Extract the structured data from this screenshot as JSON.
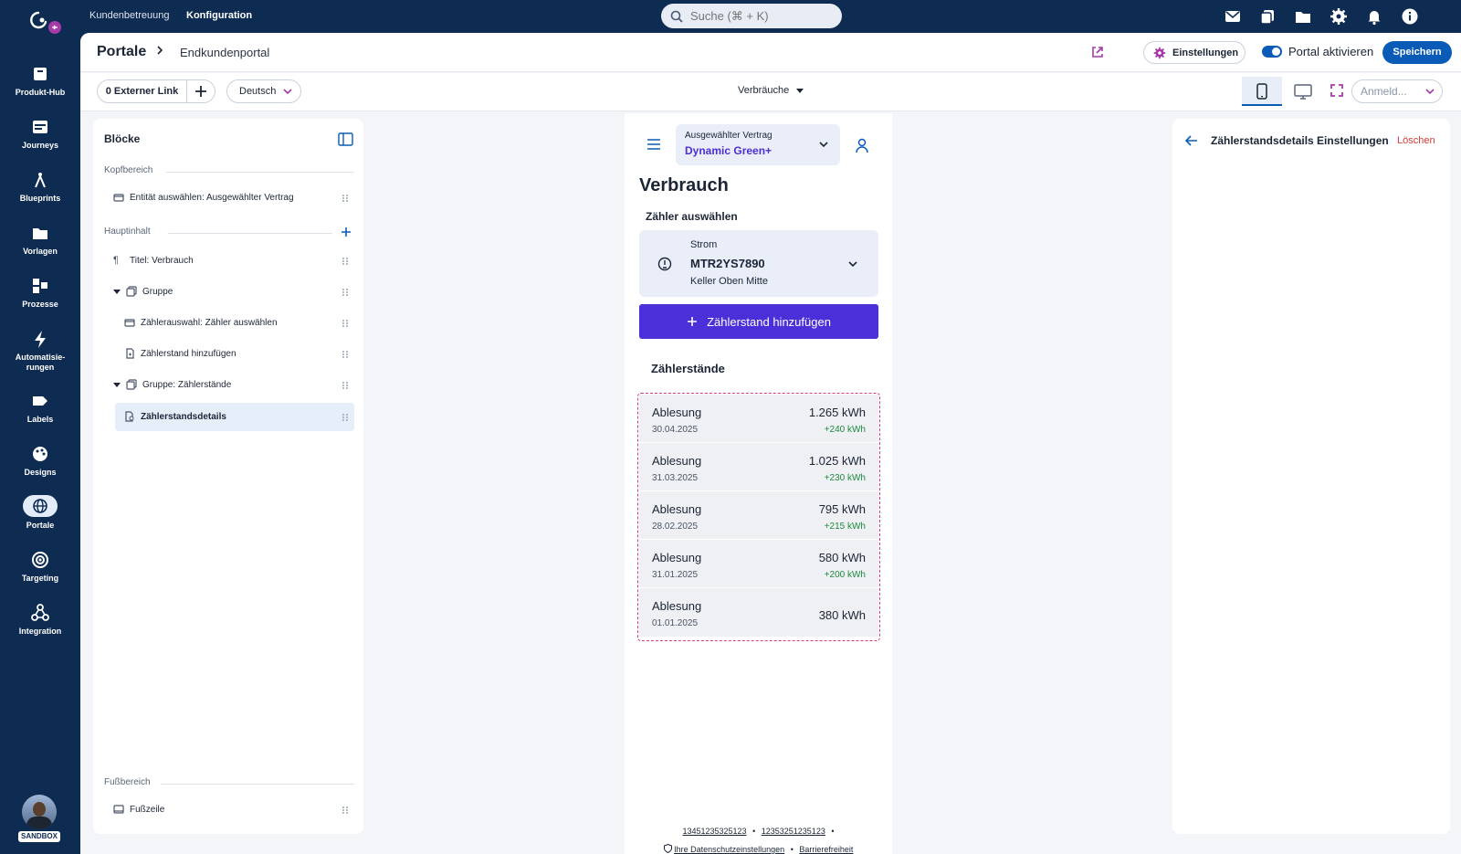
{
  "topbar": {
    "links": [
      "Kundenbetreuung",
      "Konfiguration"
    ],
    "active_link": "Konfiguration",
    "search_placeholder": "Suche (⌘ + K)",
    "icons": [
      "mail-icon",
      "copy-icon",
      "folder-icon",
      "gear-icon",
      "bell-icon",
      "info-icon"
    ]
  },
  "sidebar": {
    "items": [
      {
        "label": "Produkt-Hub",
        "icon": "box-icon"
      },
      {
        "label": "Journeys",
        "icon": "journeys-icon"
      },
      {
        "label": "Blueprints",
        "icon": "compass-icon"
      },
      {
        "label": "Vorlagen",
        "icon": "folder-icon"
      },
      {
        "label": "Prozesse",
        "icon": "process-icon"
      },
      {
        "label": "Automatisie-rungen",
        "icon": "bolt-icon"
      },
      {
        "label": "Labels",
        "icon": "tag-icon"
      },
      {
        "label": "Designs",
        "icon": "palette-icon"
      },
      {
        "label": "Portale",
        "icon": "globe-icon"
      },
      {
        "label": "Targeting",
        "icon": "target-icon"
      },
      {
        "label": "Integration",
        "icon": "integration-icon"
      }
    ],
    "active": "Portale",
    "badge": "SANDBOX"
  },
  "header": {
    "breadcrumb_root": "Portale",
    "breadcrumb_current": "Endkundenportal",
    "settings_label": "Einstellungen",
    "toggle_label": "Portal aktivieren",
    "save_label": "Speichern"
  },
  "toolbar": {
    "external_link_label": "0 Externer Link",
    "language": "Deutsch",
    "page": "Verbräuche",
    "login_placeholder": "Anmeld..."
  },
  "blocks": {
    "title": "Blöcke",
    "sections": {
      "kopf": "Kopfbereich",
      "haupt": "Hauptinhalt",
      "fuss": "Fußbereich"
    },
    "items": {
      "entity": "Entität auswählen: Ausgewählter Vertrag",
      "titel": "Titel: Verbrauch",
      "gruppe": "Gruppe",
      "zaehlerauswahl": "Zählerauswahl: Zähler auswählen",
      "zaehlerstand": "Zählerstand hinzufügen",
      "gruppe2": "Gruppe: Zählerstände",
      "details": "Zählerstandsdetails",
      "fusszeile": "Fußzeile"
    }
  },
  "preview": {
    "contract_label": "Ausgewählter Vertrag",
    "contract_value": "Dynamic Green+",
    "title": "Verbrauch",
    "meter_select_label": "Zähler auswählen",
    "meter": {
      "type": "Strom",
      "id": "MTR2YS7890",
      "location": "Keller Oben Mitte"
    },
    "add_button": "Zählerstand hinzufügen",
    "readings_title": "Zählerstände",
    "readings": [
      {
        "label": "Ablesung",
        "date": "30.04.2025",
        "value": "1.265 kWh",
        "delta": "+240 kWh"
      },
      {
        "label": "Ablesung",
        "date": "31.03.2025",
        "value": "1.025 kWh",
        "delta": "+230 kWh"
      },
      {
        "label": "Ablesung",
        "date": "28.02.2025",
        "value": "795 kWh",
        "delta": "+215 kWh"
      },
      {
        "label": "Ablesung",
        "date": "31.01.2025",
        "value": "580 kWh",
        "delta": "+200 kWh"
      },
      {
        "label": "Ablesung",
        "date": "01.01.2025",
        "value": "380 kWh",
        "delta": ""
      }
    ],
    "footer": {
      "phone1": "13451235325123",
      "phone2": "12353251235123",
      "privacy": "Ihre Datenschutzeinstellungen",
      "accessibility": "Barrierefreiheit",
      "separator": "•"
    }
  },
  "rpanel": {
    "title": "Zählerstandsdetails Einstellungen",
    "delete_label": "Löschen"
  },
  "colors": {
    "nav": "#0e2b52",
    "primary": "#0a5bb8",
    "purple": "#4b2fd8",
    "danger": "#d63a3a",
    "success": "#1f8a3f"
  }
}
